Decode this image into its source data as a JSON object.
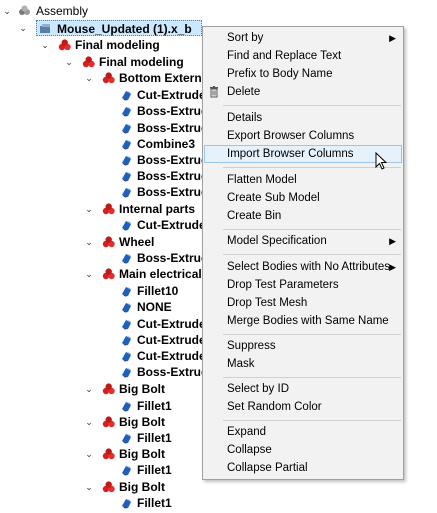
{
  "tree": {
    "root": "Assembly",
    "selected": "Mouse_Updated (1).x_b",
    "nodes": {
      "final_modeling_1": "Final modeling",
      "final_modeling_2": "Final modeling",
      "bottom_external": "Bottom External",
      "cut_extrude_1": "Cut-Extrude",
      "boss_extrude_1": "Boss-Extrude",
      "boss_extrude_2": "Boss-Extrude",
      "combine3": "Combine3",
      "boss_extrude_3": "Boss-Extrude",
      "boss_extrude_4": "Boss-Extrude",
      "boss_extrude_5": "Boss-Extrude",
      "internal_parts": "Internal parts",
      "cut_extrude_2": "Cut-Extrude",
      "wheel": "Wheel",
      "boss_extrude_6": "Boss-Extrude",
      "main_electrical": "Main electrical",
      "fillet10": "Fillet10",
      "none": "NONE",
      "cut_extrude_3": "Cut-Extrude",
      "cut_extrude_4": "Cut-Extrude",
      "cut_extrude_5": "Cut-Extrude",
      "boss_extrude_7": "Boss-Extrude",
      "big_bolt_1": "Big Bolt",
      "fillet1_1": "Fillet1",
      "big_bolt_2": "Big Bolt",
      "fillet1_2": "Fillet1",
      "big_bolt_3": "Big Bolt",
      "fillet1_3": "Fillet1",
      "big_bolt_4": "Big Bolt",
      "fillet1_4": "Fillet1"
    }
  },
  "menu": {
    "sort_by": "Sort by",
    "find_replace": "Find and Replace Text",
    "prefix_body": "Prefix to Body Name",
    "delete": "Delete",
    "details": "Details",
    "export_cols": "Export Browser Columns",
    "import_cols": "Import Browser Columns",
    "flatten": "Flatten Model",
    "create_sub": "Create Sub Model",
    "create_bin": "Create Bin",
    "model_spec": "Model Specification",
    "select_no_attr": "Select Bodies with No Attributes",
    "drop_test_params": "Drop Test Parameters",
    "drop_test_mesh": "Drop Test Mesh",
    "merge_bodies": "Merge Bodies with Same Name",
    "suppress": "Suppress",
    "mask": "Mask",
    "select_by_id": "Select by ID",
    "set_random_color": "Set Random Color",
    "expand": "Expand",
    "collapse": "Collapse",
    "collapse_partial": "Collapse Partial"
  },
  "icons": {
    "assembly": "assembly-icon",
    "part": "part-icon",
    "body": "body-icon",
    "trash": "trash-icon",
    "submenu": "submenu-arrow-icon",
    "cursor": "mouse-cursor-icon"
  },
  "colors": {
    "part_red": "#d62020",
    "body_blue": "#1f5fbf",
    "selection": "#cce8ff",
    "menu_bg": "#f2f2f2",
    "menu_highlight": "#e5f1fb"
  }
}
